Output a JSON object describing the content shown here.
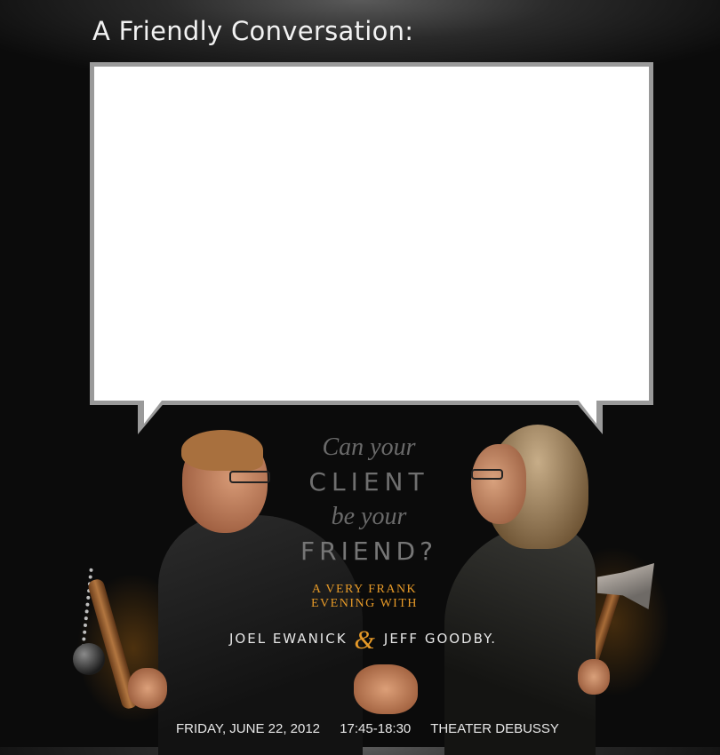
{
  "header": {
    "title": "A Friendly Conversation:"
  },
  "poster": {
    "headline": {
      "line1": "Can your",
      "line2": "CLIENT",
      "line3": "be your",
      "line4": "FRIEND?"
    },
    "tagline": {
      "line1": "A VERY FRANK",
      "line2": "EVENING WITH"
    },
    "speakers": {
      "left": "JOEL EWANICK",
      "ampersand": "&",
      "right": "JEFF GOODBY."
    },
    "event": {
      "date": "FRIDAY, JUNE 22, 2012",
      "time": "17:45-18:30",
      "venue": "THEATER DEBUSSY"
    }
  },
  "colors": {
    "accent": "#e79a28",
    "bubble_border": "#9a9a9a",
    "background": "#0b0b0b"
  }
}
